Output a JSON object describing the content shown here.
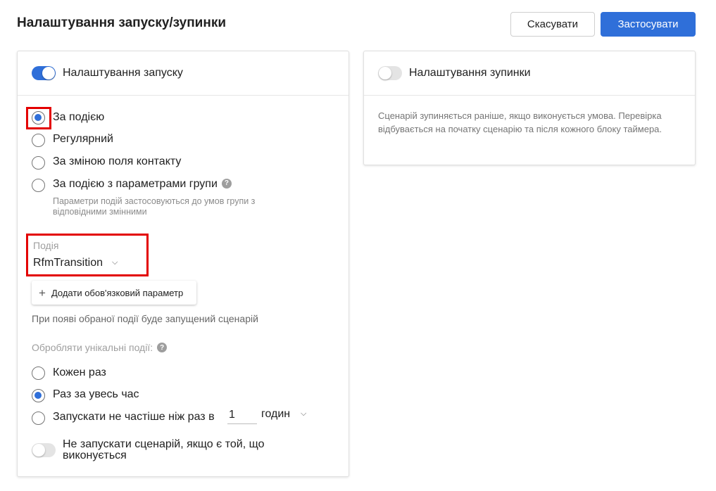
{
  "header": {
    "title": "Налаштування запуску/зупинки",
    "cancel_label": "Скасувати",
    "apply_label": "Застосувати"
  },
  "colors": {
    "accent": "#2f6fd9",
    "highlight": "#e30000"
  },
  "start_panel": {
    "toggle_on": true,
    "title": "Налаштування запуску",
    "trigger_options": [
      {
        "label": "За подією",
        "checked": true
      },
      {
        "label": "Регулярний",
        "checked": false
      },
      {
        "label": "За зміною поля контакту",
        "checked": false
      },
      {
        "label": "За подією з параметрами групи",
        "checked": false
      }
    ],
    "group_params_hint": "Параметри подій застосовуються до умов групи з відповідними змінними",
    "event_field_label": "Подія",
    "event_field_value": "RfmTransition",
    "add_param_label": "Додати обов'язковий параметр",
    "event_description": "При появі обраної події буде запущений сценарій",
    "unique_events_label": "Обробляти унікальні події:",
    "unique_options": [
      {
        "label": "Кожен раз",
        "checked": false
      },
      {
        "label": "Раз за увесь час",
        "checked": true
      },
      {
        "label": "Запускати не частіше ніж раз в",
        "checked": false
      }
    ],
    "interval_value": "1",
    "interval_unit": "годин",
    "no_parallel_toggle_on": false,
    "no_parallel_label": "Не запускати сценарій, якщо є той, що виконується"
  },
  "stop_panel": {
    "toggle_on": false,
    "title": "Налаштування зупинки",
    "description": "Сценарій зупиняється раніше, якщо виконується умова. Перевірка відбувається на початку сценарію та після кожного блоку таймера."
  },
  "icons": {
    "help": "question-icon",
    "dropdown": "chevron-down-icon",
    "plus": "plus-icon"
  }
}
